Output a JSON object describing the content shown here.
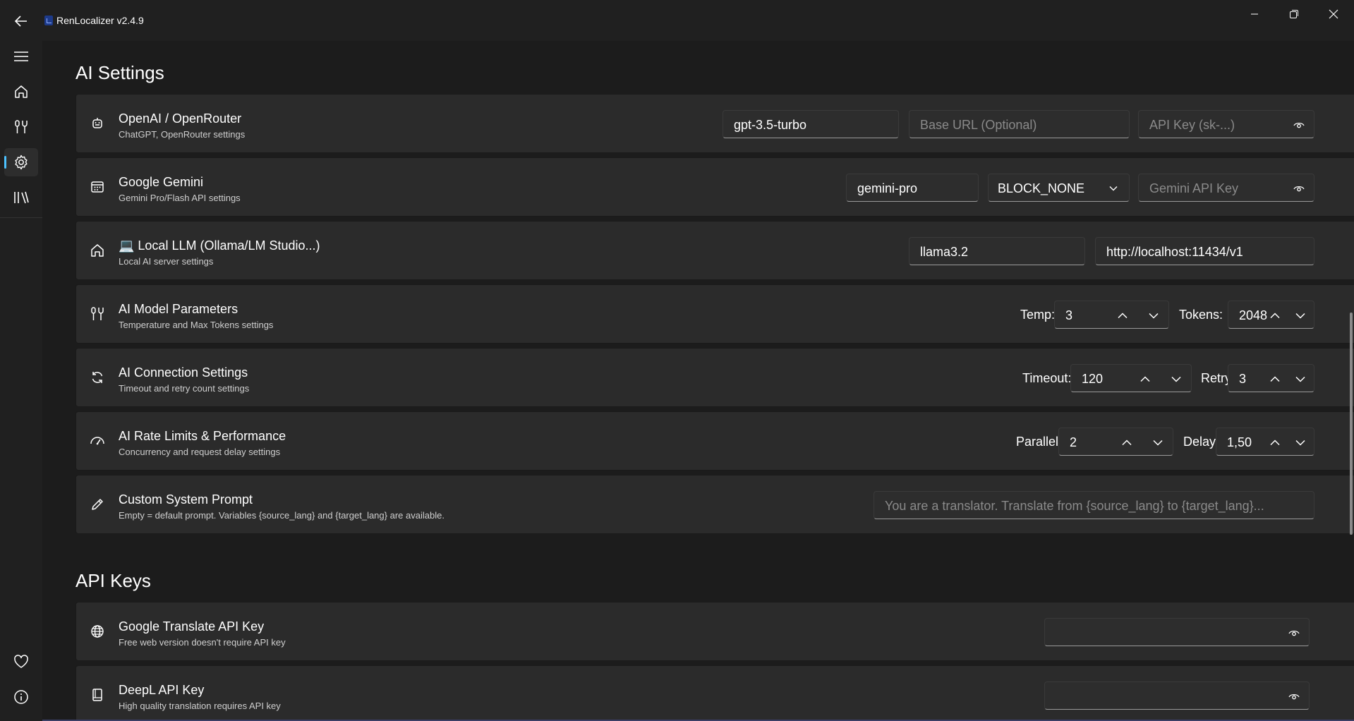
{
  "window": {
    "title": "RenLocalizer v2.4.9",
    "accent": "#4cc2ff"
  },
  "nav": {
    "items": [
      {
        "name": "menu",
        "icon": "hamburger-icon"
      },
      {
        "name": "home",
        "icon": "home-icon"
      },
      {
        "name": "tools",
        "icon": "tools-icon"
      },
      {
        "name": "settings",
        "icon": "gear-icon",
        "active": true
      },
      {
        "name": "library",
        "icon": "library-icon"
      },
      {
        "name": "favorites",
        "icon": "heart-icon"
      },
      {
        "name": "about",
        "icon": "info-icon"
      }
    ]
  },
  "ai_settings": {
    "title": "AI Settings",
    "openai": {
      "title": "OpenAI / OpenRouter",
      "subtitle": "ChatGPT, OpenRouter settings",
      "model": "gpt-3.5-turbo",
      "base_url_placeholder": "Base URL (Optional)",
      "api_key_placeholder": "API Key (sk-...)"
    },
    "gemini": {
      "title": "Google Gemini",
      "subtitle": "Gemini Pro/Flash API settings",
      "model": "gemini-pro",
      "safety": "BLOCK_NONE",
      "api_key_placeholder": "Gemini API Key"
    },
    "local_llm": {
      "title": "💻 Local LLM (Ollama/LM Studio...)",
      "subtitle": "Local AI server settings",
      "model": "llama3.2",
      "url": "http://localhost:11434/v1"
    },
    "params": {
      "title": "AI Model Parameters",
      "subtitle": "Temperature and Max Tokens settings",
      "temp_label": "Temp:",
      "temp": "3",
      "tokens_label": "Tokens:",
      "tokens": "2048"
    },
    "connection": {
      "title": "AI Connection Settings",
      "subtitle": "Timeout and retry count settings",
      "timeout_label": "Timeout:",
      "timeout": "120",
      "retry_label": "Retry:",
      "retry": "3"
    },
    "rate": {
      "title": "AI Rate Limits & Performance",
      "subtitle": "Concurrency and request delay settings",
      "parallel_label": "Parallel:",
      "parallel": "2",
      "delay_label": "Delay:",
      "delay": "1,50"
    },
    "prompt": {
      "title": "Custom System Prompt",
      "subtitle": "Empty = default prompt. Variables {source_lang} and {target_lang} are available.",
      "placeholder": "You are a translator. Translate from {source_lang} to {target_lang}..."
    }
  },
  "api_keys": {
    "title": "API Keys",
    "google": {
      "title": "Google Translate API Key",
      "subtitle": "Free web version doesn't require API key"
    },
    "deepl": {
      "title": "DeepL API Key",
      "subtitle": "High quality translation requires API key"
    }
  }
}
